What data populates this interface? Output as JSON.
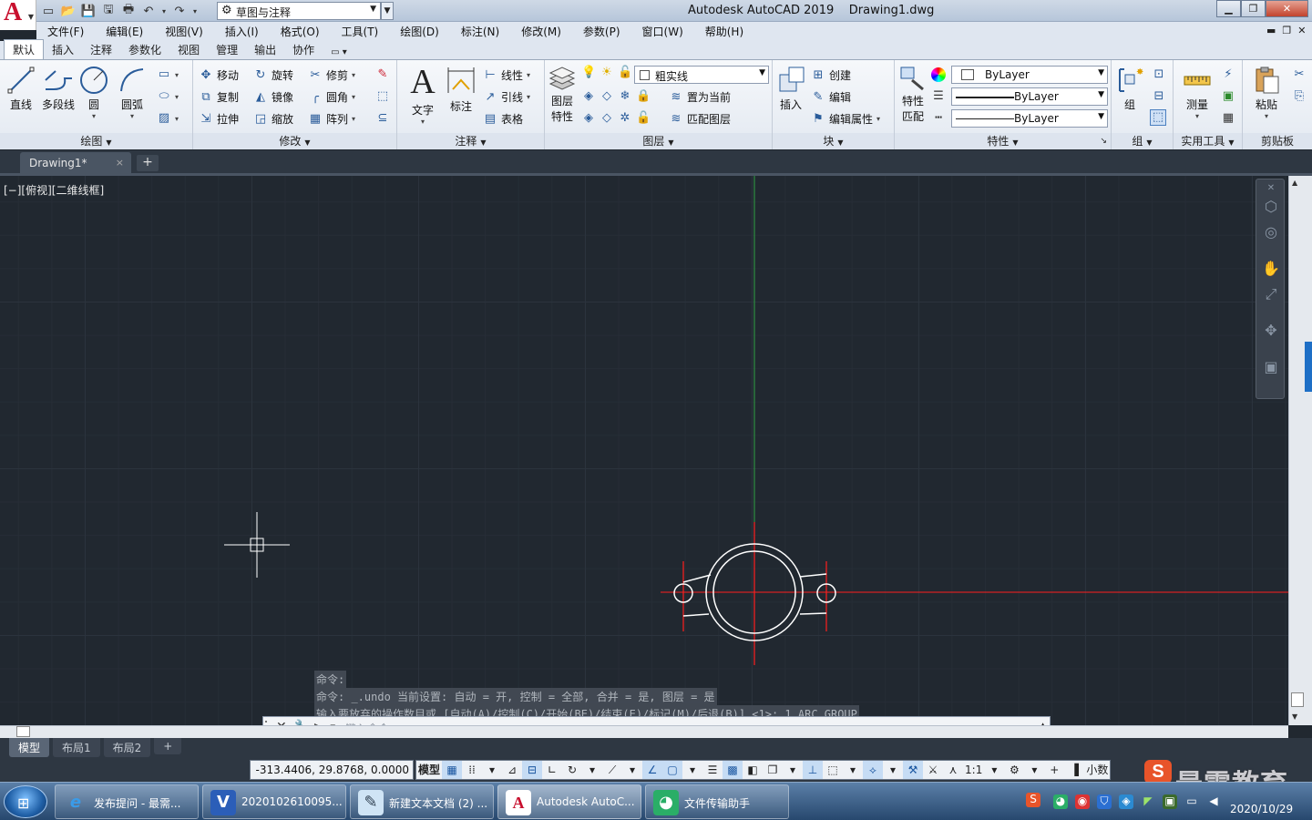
{
  "app": {
    "title": "Autodesk AutoCAD 2019",
    "file": "Drawing1.dwg",
    "logo_letter": "A"
  },
  "workspace": "草图与注释",
  "menu": [
    "文件(F)",
    "编辑(E)",
    "视图(V)",
    "插入(I)",
    "格式(O)",
    "工具(T)",
    "绘图(D)",
    "标注(N)",
    "修改(M)",
    "参数(P)",
    "窗口(W)",
    "帮助(H)"
  ],
  "ribbon_tabs": [
    "默认",
    "插入",
    "注释",
    "参数化",
    "视图",
    "管理",
    "输出",
    "协作"
  ],
  "ribbon": {
    "draw": {
      "title": "绘图",
      "line": "直线",
      "polyline": "多段线",
      "circle": "圆",
      "arc": "圆弧"
    },
    "modify": {
      "title": "修改",
      "move": "移动",
      "rotate": "旋转",
      "trim": "修剪",
      "copy": "复制",
      "mirror": "镜像",
      "fillet": "圆角",
      "stretch": "拉伸",
      "scale": "缩放",
      "array": "阵列"
    },
    "annotation": {
      "title": "注释",
      "text": "文字",
      "dimension": "标注",
      "linear": "线性",
      "leader": "引线",
      "table": "表格"
    },
    "layers": {
      "title": "图层",
      "layer_props_1": "图层",
      "layer_props_2": "特性",
      "current_layer": "粗实线",
      "set_current": "置为当前",
      "match_layer": "匹配图层"
    },
    "block": {
      "title": "块",
      "insert": "插入",
      "create": "创建",
      "edit": "编辑",
      "edit_attr": "编辑属性"
    },
    "properties": {
      "title": "特性",
      "match_1": "特性",
      "match_2": "匹配",
      "color": "ByLayer",
      "linetype": "ByLayer",
      "lineweight": "ByLayer"
    },
    "groups": {
      "title": "组",
      "group": "组"
    },
    "utilities": {
      "title": "实用工具",
      "measure": "测量"
    },
    "clipboard": {
      "title": "剪贴板",
      "paste": "粘贴"
    }
  },
  "doc_tab": {
    "name": "Drawing1*",
    "close": "×",
    "plus": "+"
  },
  "viewport_label": "[−][俯视][二维线框]",
  "command": {
    "history": [
      "命令:",
      "命令: _.undo 当前设置: 自动 = 开, 控制 = 全部, 合并 = 是, 图层 = 是",
      "输入要放弃的操作数目或 [自动(A)/控制(C)/开始(BE)/结束(E)/标记(M)/后退(B)] <1>: 1 ARC GROUP"
    ],
    "placeholder": "键入命令"
  },
  "layout_tabs": [
    "模型",
    "布局1",
    "布局2"
  ],
  "status": {
    "coords": "-313.4406, 29.8768, 0.0000",
    "model": "模型",
    "scale": "1:1",
    "units": "小数"
  },
  "taskbar": {
    "items": [
      "发布提问 - 最需...",
      "2020102610095...",
      "新建文本文档 (2) ...",
      "Autodesk AutoC...",
      "文件传输助手"
    ],
    "date": "2020/10/29"
  },
  "watermark": "最需教育",
  "colors": {
    "canvas": "#212830",
    "red": "#ff1e1e",
    "white": "#ffffff",
    "green": "#2ea043",
    "ribbon_bg": "#e9eef5"
  }
}
